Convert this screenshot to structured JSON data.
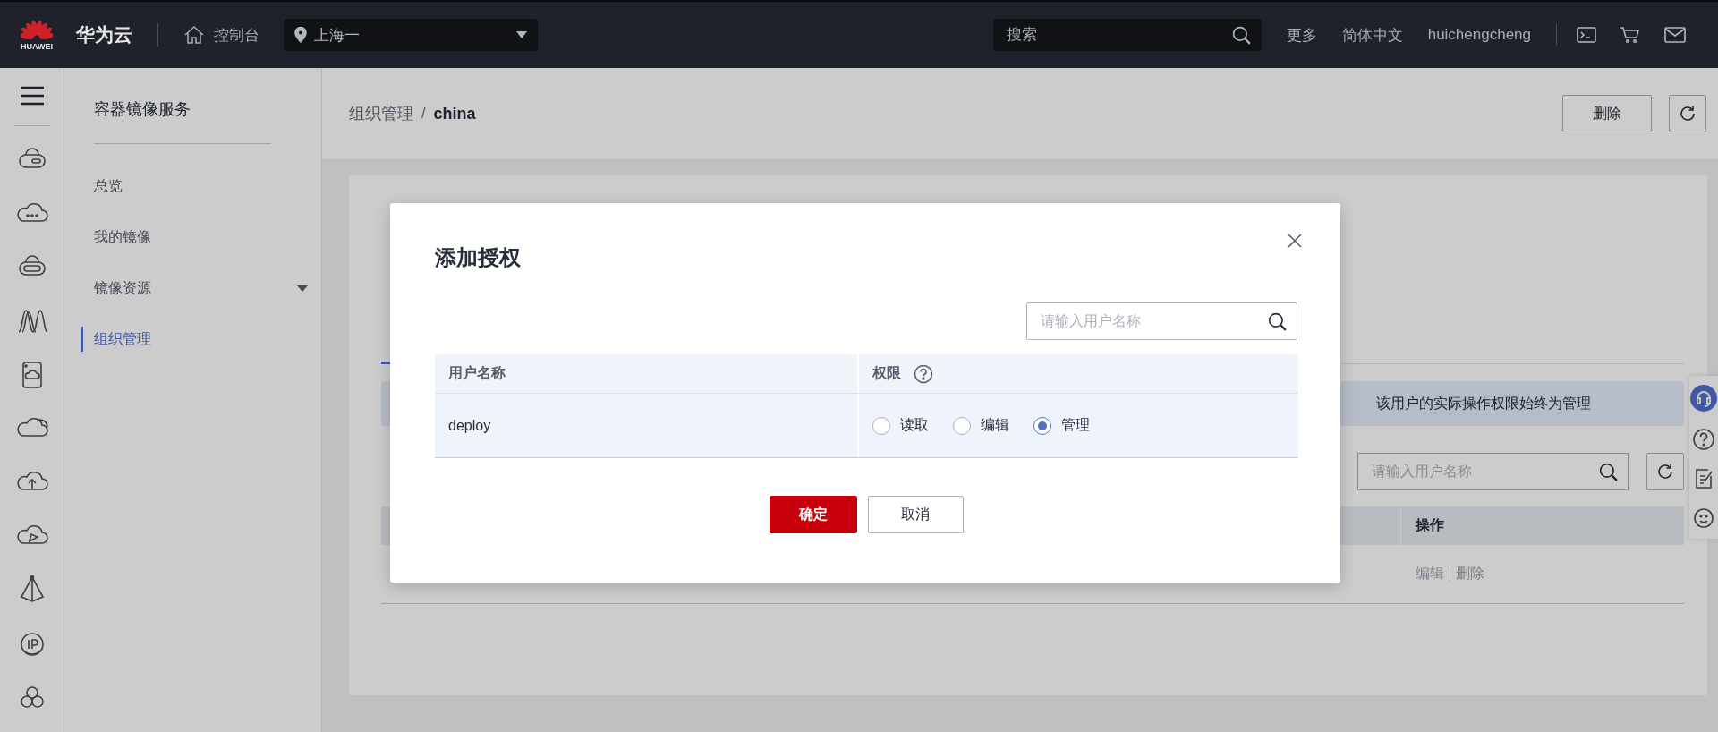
{
  "top_bar": {
    "brand": "HUAWEI",
    "title": "华为云",
    "console": "控制台",
    "region": "上海一",
    "search": {
      "placeholder": "搜索"
    },
    "links": [
      "更多",
      "简体中文",
      "huichengcheng"
    ]
  },
  "service_menu": {
    "title": "容器镜像服务",
    "items": [
      {
        "label": "总览",
        "selected": false,
        "expandable": false
      },
      {
        "label": "我的镜像",
        "selected": false,
        "expandable": false
      },
      {
        "label": "镜像资源",
        "selected": false,
        "expandable": true
      },
      {
        "label": "组织管理",
        "selected": true,
        "expandable": false
      }
    ]
  },
  "breadcrumb": {
    "parent": "组织管理",
    "separator": "/",
    "current": "china"
  },
  "header_buttons": [
    "删除"
  ],
  "tabs": [
    {
      "selected": true
    }
  ],
  "notice": "该用户的实际操作权限始终为管理",
  "member_search": {
    "placeholder": "请输入用户名称"
  },
  "members_table": {
    "columns": [
      "操作"
    ],
    "rows": [
      {
        "actions": [
          "编辑",
          "删除"
        ]
      }
    ]
  },
  "dialog": {
    "title": "添加授权",
    "search": {
      "placeholder": "请输入用户名称"
    },
    "columns": [
      "用户名称",
      "权限"
    ],
    "rows": [
      {
        "user": "deploy",
        "options": [
          {
            "label": "读取",
            "selected": false
          },
          {
            "label": "编辑",
            "selected": false
          },
          {
            "label": "管理",
            "selected": true
          }
        ]
      }
    ],
    "buttons": [
      {
        "label": "确定",
        "kind": "primary"
      },
      {
        "label": "取消",
        "kind": "secondary"
      }
    ]
  }
}
